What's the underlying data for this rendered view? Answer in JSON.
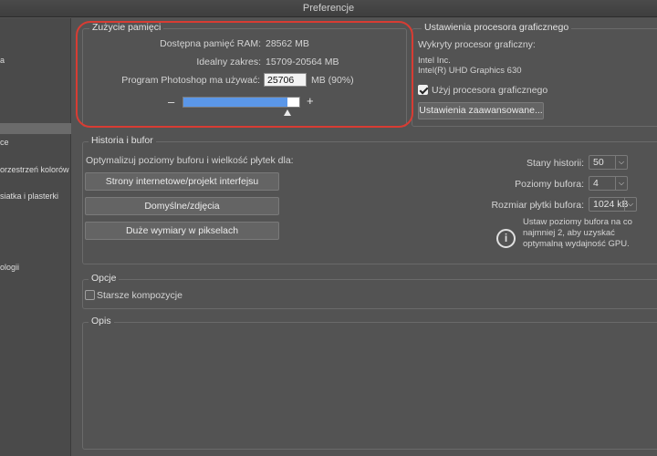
{
  "window": {
    "title": "Preferencje"
  },
  "sidebar": {
    "items": [
      {
        "label": "a"
      },
      {
        "label": "ce"
      },
      {
        "label": "orzestrzeń kolorów"
      },
      {
        "label": "siatka i plasterki"
      },
      {
        "label": "ologii"
      }
    ]
  },
  "memory": {
    "title": "Zużycie pamięci",
    "available_label": "Dostępna pamięć RAM:",
    "available_value": "28562 MB",
    "ideal_label": "Idealny zakres:",
    "ideal_value": "15709-20564 MB",
    "use_label": "Program Photoshop ma używać:",
    "use_value": "25706",
    "use_unit": "MB (90%)",
    "slider_fraction": 0.9,
    "minus": "–",
    "plus": "+"
  },
  "gpu": {
    "title": "Ustawienia procesora graficznego",
    "detected_label": "Wykryty procesor graficzny:",
    "vendor": "Intel Inc.",
    "model": "Intel(R) UHD Graphics 630",
    "use_gpu_label": "Użyj procesora graficznego",
    "use_gpu_checked": true,
    "advanced_button": "Ustawienia zaawansowane..."
  },
  "history": {
    "title": "Historia i bufor",
    "optimize_label": "Optymalizuj poziomy buforu i wielkość płytek dla:",
    "buttons": [
      "Strony internetowe/projekt interfejsu",
      "Domyślne/zdjęcia",
      "Duże wymiary w pikselach"
    ],
    "states_label": "Stany historii:",
    "states_value": "50",
    "cache_levels_label": "Poziomy bufora:",
    "cache_levels_value": "4",
    "tile_size_label": "Rozmiar płytki bufora:",
    "tile_size_value": "1024 kB",
    "info_line1": "Ustaw poziomy bufora na co",
    "info_line2": "najmniej 2, aby uzyskać",
    "info_line3": "optymalną wydajność GPU."
  },
  "options": {
    "title": "Opcje",
    "legacy_label": "Starsze kompozycje",
    "legacy_checked": false
  },
  "description": {
    "title": "Opis"
  },
  "colors": {
    "highlight": "#d83c33",
    "slider": "#5b97e8"
  }
}
